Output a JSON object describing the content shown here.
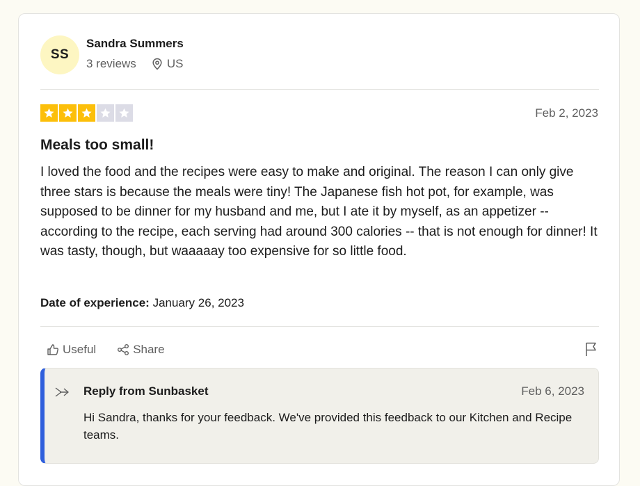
{
  "reviewer": {
    "initials": "SS",
    "name": "Sandra Summers",
    "reviews": "3 reviews",
    "country": "US"
  },
  "review": {
    "rating": 3,
    "max_rating": 5,
    "date": "Feb 2, 2023",
    "title": "Meals too small!",
    "body": "I loved the food and the recipes were easy to make and original. The reason I can only give three stars is because the meals were tiny! The Japanese fish hot pot, for example, was supposed to be dinner for my husband and me, but I ate it by myself, as an appetizer -- according to the recipe, each serving had around 300 calories -- that is not enough for dinner! It was tasty, though, but waaaaay too expensive for so little food.",
    "experience_label": "Date of experience:",
    "experience_date": "January 26, 2023"
  },
  "actions": {
    "useful": "Useful",
    "share": "Share"
  },
  "reply": {
    "title": "Reply from Sunbasket",
    "date": "Feb 6, 2023",
    "body": "Hi Sandra, thanks for your feedback. We've provided this feedback to our Kitchen and Recipe teams."
  },
  "colors": {
    "star_on": "#fcbf0a",
    "star_off": "#dcdce6",
    "avatar_bg": "#fdf6c2",
    "reply_accent": "#2f5fdc"
  },
  "icons": [
    "location-pin-icon",
    "star-icon",
    "thumbs-up-icon",
    "share-icon",
    "flag-icon",
    "reply-arrow-icon"
  ]
}
